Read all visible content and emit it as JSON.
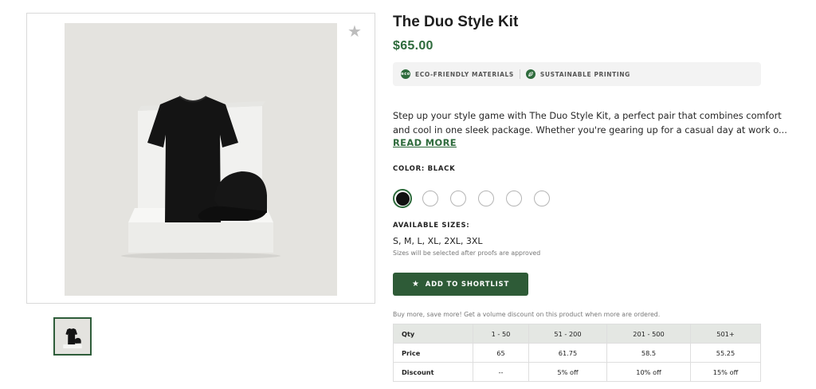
{
  "product": {
    "title": "The Duo Style Kit",
    "price": "$65.00",
    "badges": [
      {
        "icon": "eco-icon",
        "label": "ECO-FRIENDLY MATERIALS"
      },
      {
        "icon": "leaf-icon",
        "label": "SUSTAINABLE PRINTING"
      }
    ],
    "description_line1": "Step up your style game with The Duo Style Kit, a perfect pair that combines comfort",
    "description_line2": "and cool in one sleek package. Whether you're gearing up for a casual day at work o...",
    "read_more": "READ MORE",
    "color_label": "COLOR: BLACK",
    "swatches": [
      {
        "name": "black",
        "selected": true
      },
      {
        "name": "white",
        "selected": false
      },
      {
        "name": "white",
        "selected": false
      },
      {
        "name": "white",
        "selected": false
      },
      {
        "name": "white",
        "selected": false
      },
      {
        "name": "white",
        "selected": false
      }
    ],
    "sizes_label": "AVAILABLE SIZES:",
    "sizes_value": "S, M, L, XL, 2XL, 3XL",
    "sizes_note": "Sizes will be selected after proofs are approved",
    "shortlist_label": "ADD TO SHORTLIST",
    "volume_note": "Buy more, save more! Get a volume discount on this product when more are ordered."
  },
  "volume_table": {
    "headers": [
      "Qty",
      "1 - 50",
      "51 - 200",
      "201 - 500",
      "501+"
    ],
    "rows": [
      [
        "Price",
        "65",
        "61.75",
        "58.5",
        "55.25"
      ],
      [
        "Discount",
        "--",
        "5% off",
        "10% off",
        "15% off"
      ]
    ]
  },
  "colors": {
    "accent_green": "#2e6b3c",
    "button_green": "#2e5b37",
    "image_background": "#e4e3df"
  },
  "icons": {
    "favorite": "star-icon"
  }
}
